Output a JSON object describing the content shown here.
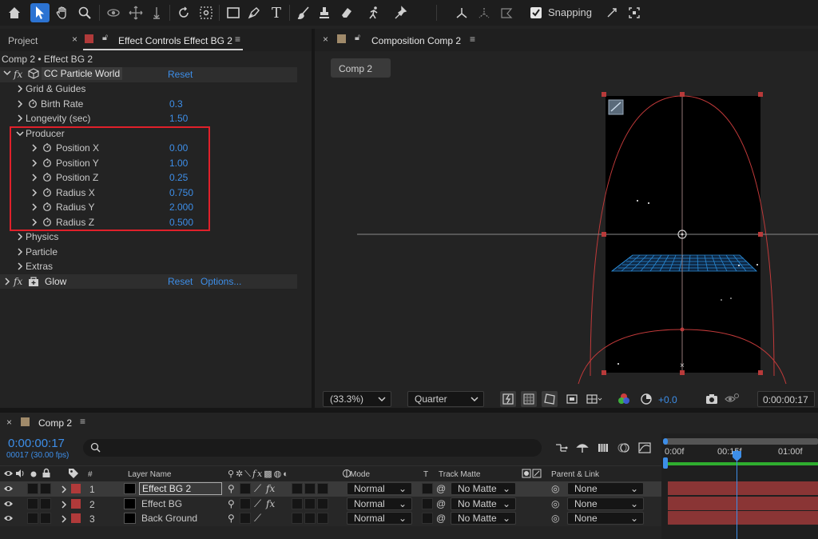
{
  "toolbar": {
    "snapping_label": "Snapping",
    "snapping_checked": true
  },
  "effects_panel": {
    "tab_project": "Project",
    "tab_effect_controls": "Effect Controls Effect BG 2",
    "breadcrumb": "Comp 2 • Effect BG 2",
    "effect1": {
      "fx": "fx",
      "name": "CC Particle World",
      "reset": "Reset"
    },
    "properties": [
      {
        "label": "Grid & Guides",
        "value": ""
      },
      {
        "label": "Birth Rate",
        "value": "0.3"
      },
      {
        "label": "Longevity (sec)",
        "value": "1.50"
      },
      {
        "label": "Producer",
        "value": ""
      },
      {
        "label": "Position X",
        "value": "0.00"
      },
      {
        "label": "Position Y",
        "value": "1.00"
      },
      {
        "label": "Position Z",
        "value": "0.25"
      },
      {
        "label": "Radius X",
        "value": "0.750"
      },
      {
        "label": "Radius Y",
        "value": "2.000"
      },
      {
        "label": "Radius Z",
        "value": "0.500"
      },
      {
        "label": "Physics",
        "value": ""
      },
      {
        "label": "Particle",
        "value": ""
      },
      {
        "label": "Extras",
        "value": ""
      }
    ],
    "effect2": {
      "fx": "fx",
      "name": "Glow",
      "reset": "Reset",
      "options": "Options..."
    }
  },
  "composition_panel": {
    "tab": "Composition Comp 2",
    "comp_tab": "Comp 2",
    "zoom": "(33.3%)",
    "resolution": "Quarter",
    "exposure": "+0.0",
    "timecode": "0:00:00:17"
  },
  "timeline": {
    "tab": "Comp 2",
    "current_time": "0:00:00:17",
    "frame_info": "00017 (30.00 fps)",
    "search_placeholder": "",
    "columns": {
      "hash": "#",
      "layer_name": "Layer Name",
      "mode": "Mode",
      "t": "T",
      "track_matte": "Track Matte",
      "parent_link": "Parent & Link"
    },
    "ruler": [
      "0:00f",
      "00:15f",
      "01:00f"
    ],
    "layers": [
      {
        "num": "1",
        "name": "Effect BG 2",
        "fx": "fx",
        "mode": "Normal",
        "matte": "No Matte",
        "parent": "None",
        "color": "#b03a3a"
      },
      {
        "num": "2",
        "name": "Effect BG",
        "fx": "fx",
        "mode": "Normal",
        "matte": "No Matte",
        "parent": "None",
        "color": "#b03a3a"
      },
      {
        "num": "3",
        "name": "Back Ground",
        "fx": "",
        "mode": "Normal",
        "matte": "No Matte",
        "parent": "None",
        "color": "#b03a3a"
      }
    ]
  },
  "colors": {
    "accent": "#2c73d2",
    "link_blue": "#3d8ee8",
    "highlight_box": "#e0202a",
    "layer_bar": "#8a3535",
    "grid_blue": "#2a8bd6",
    "comp_guide": "#c23a3a"
  }
}
